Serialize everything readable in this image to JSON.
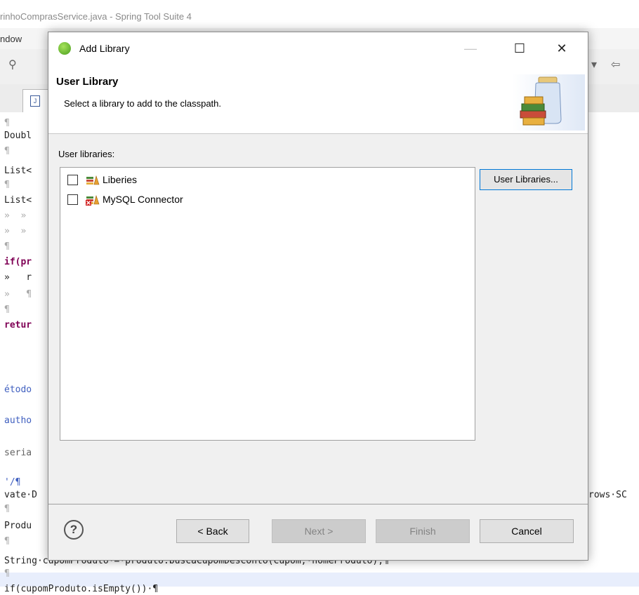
{
  "ide": {
    "window_title": "rinhoComprasService.java - Spring Tool Suite 4",
    "menu_item": "ndow",
    "code_lines": [
      {
        "text": "¶",
        "cls": "pil"
      },
      {
        "text": "Doubl",
        "cls": ""
      },
      {
        "text": "¶",
        "cls": "pil"
      },
      {
        "text": "List<",
        "cls": ""
      },
      {
        "text": "¶",
        "cls": "pil"
      },
      {
        "text": "List<",
        "cls": ""
      },
      {
        "text": "»  »",
        "cls": "pil"
      },
      {
        "text": "»  »",
        "cls": "pil"
      },
      {
        "text": "¶",
        "cls": "pil"
      },
      {
        "text": "if(pr",
        "cls": "kw"
      },
      {
        "text": "»   r",
        "cls": ""
      },
      {
        "text": "»   ¶",
        "cls": "pil"
      },
      {
        "text": "¶",
        "cls": "pil"
      },
      {
        "text": "retur",
        "cls": "kw"
      },
      {
        "text": "",
        "cls": ""
      },
      {
        "text": "",
        "cls": ""
      },
      {
        "text": "étodo",
        "cls": "cmt"
      },
      {
        "text": "",
        "cls": ""
      },
      {
        "text": "autho",
        "cls": "cmt"
      },
      {
        "text": "",
        "cls": ""
      },
      {
        "text": "seria",
        "cls": "ann"
      },
      {
        "text": "",
        "cls": ""
      },
      {
        "text": "'/¶",
        "cls": "cmt"
      },
      {
        "text": "vate·D",
        "cls": ""
      },
      {
        "text": "¶",
        "cls": "pil"
      },
      {
        "text": "Produ",
        "cls": ""
      },
      {
        "text": "¶",
        "cls": "pil"
      },
      {
        "text": "String·cupomProduto·=·produto.buscaCupomDesconto(cupom,·nomeProduto);¶",
        "cls": ""
      },
      {
        "text": "¶",
        "cls": "pil"
      },
      {
        "text": "if(cupomProduto.isEmpty())·¶",
        "cls": ""
      }
    ],
    "right_code_fragment": "rows·SC"
  },
  "dialog": {
    "title": "Add Library",
    "header_title": "User Library",
    "header_description": "Select a library to add to the classpath.",
    "list_label": "User libraries:",
    "libraries": [
      {
        "name": "Liberies",
        "checked": false,
        "error": false
      },
      {
        "name": "MySQL Connector",
        "checked": false,
        "error": true
      }
    ],
    "user_libraries_button": "User Libraries...",
    "help_symbol": "?",
    "back_button": "< Back",
    "next_button": "Next >",
    "finish_button": "Finish",
    "cancel_button": "Cancel",
    "window_controls": {
      "minimize": "—",
      "maximize": "☐",
      "close": "✕"
    }
  }
}
